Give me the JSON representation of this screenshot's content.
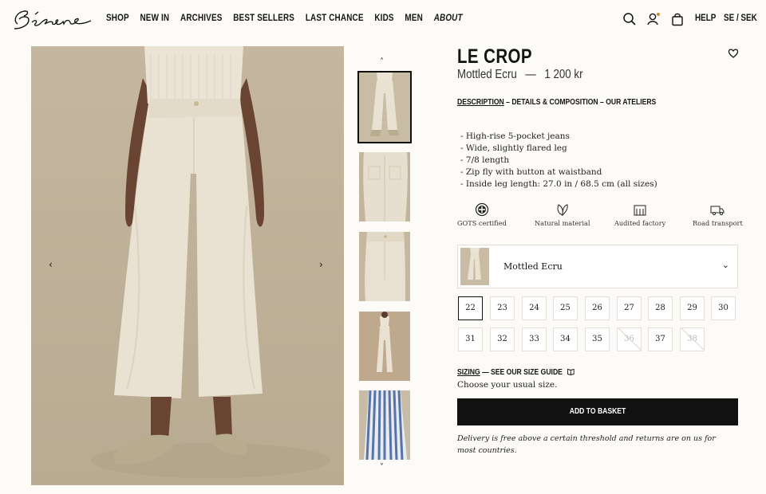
{
  "header": {
    "logo_text": "Sézane",
    "nav": [
      "SHOP",
      "NEW IN",
      "ARCHIVES",
      "BEST SELLERS",
      "LAST CHANCE",
      "KIDS",
      "MEN",
      "ABOUT"
    ],
    "help": "HELP",
    "locale": "SE  /  SEK",
    "icons": [
      "search-icon",
      "account-icon",
      "bag-icon"
    ]
  },
  "gallery": {
    "prev": "‹",
    "next": "›",
    "thumb_up": "˄",
    "thumb_down": "˅"
  },
  "product": {
    "title": "LE CROP",
    "color": "Mottled Ecru",
    "separator": "—",
    "price": "1 200 kr",
    "tabs": {
      "description": "DESCRIPTION",
      "sep1": " – ",
      "details": "DETAILS & COMPOSITION",
      "sep2": " – ",
      "ateliers": "OUR ATELIERS"
    },
    "description": [
      "- High-rise 5-pocket jeans",
      "- Wide, slightly flared leg",
      "- 7/8 length",
      "- Zip fly with button at waistband",
      "- Inside leg length: 27.0 in / 68.5 cm (all sizes)"
    ],
    "features": [
      "GOTS certified",
      "Natural material",
      "Audited factory",
      "Road transport"
    ],
    "color_select": {
      "label": "Mottled Ecru"
    },
    "sizes": [
      {
        "label": "22",
        "state": "selected"
      },
      {
        "label": "23",
        "state": "available"
      },
      {
        "label": "24",
        "state": "available"
      },
      {
        "label": "25",
        "state": "available"
      },
      {
        "label": "26",
        "state": "available"
      },
      {
        "label": "27",
        "state": "available"
      },
      {
        "label": "28",
        "state": "available"
      },
      {
        "label": "29",
        "state": "available"
      },
      {
        "label": "30",
        "state": "available"
      },
      {
        "label": "31",
        "state": "available"
      },
      {
        "label": "32",
        "state": "available"
      },
      {
        "label": "33",
        "state": "available"
      },
      {
        "label": "34",
        "state": "available"
      },
      {
        "label": "35",
        "state": "available"
      },
      {
        "label": "36",
        "state": "unavailable"
      },
      {
        "label": "37",
        "state": "available"
      },
      {
        "label": "38",
        "state": "unavailable"
      }
    ],
    "sizing": {
      "label": "SIZING",
      "sep": " — ",
      "guide": "SEE OUR SIZE GUIDE"
    },
    "usual_size": "Choose your usual size.",
    "add_to_basket": "ADD TO BASKET",
    "delivery_note": "Delivery is free above a certain threshold and returns are on us for most countries."
  }
}
